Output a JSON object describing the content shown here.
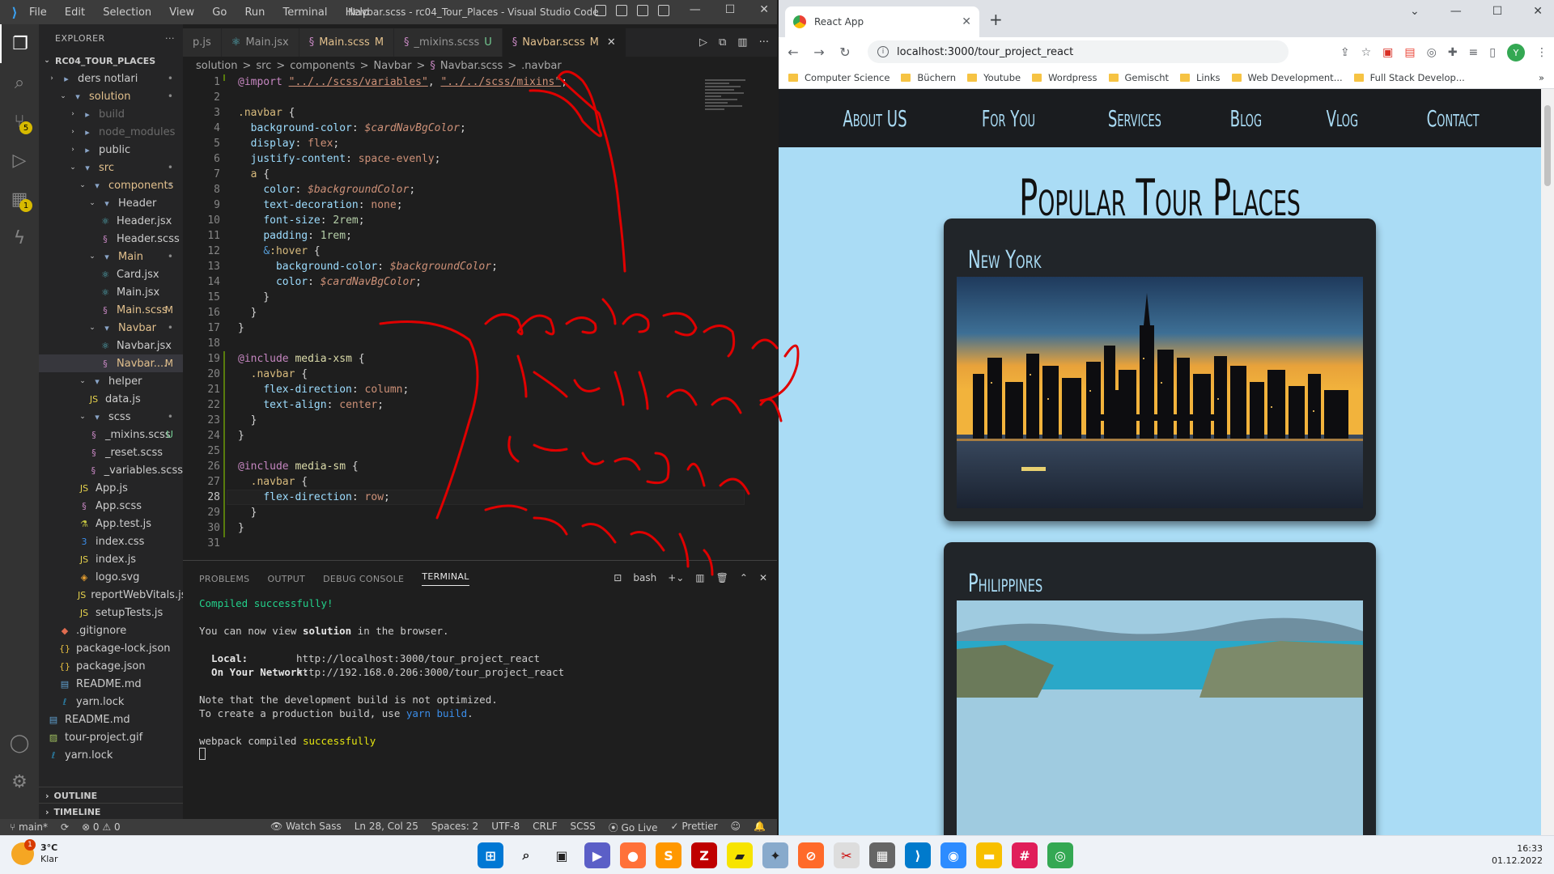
{
  "vscode": {
    "menu": [
      "File",
      "Edit",
      "Selection",
      "View",
      "Go",
      "Run",
      "Terminal",
      "Help"
    ],
    "window_title": "Navbar.scss - rc04_Tour_Places - Visual Studio Code",
    "activity_badges": {
      "scm": "5",
      "extensions": "1"
    },
    "explorer": {
      "title": "EXPLORER",
      "root": "RC04_TOUR_PLACES",
      "items": [
        {
          "label": "ders notlari",
          "icon": "folder",
          "color": "#cccccc",
          "status": "•"
        },
        {
          "label": "solution",
          "icon": "folder-open",
          "color": "#e2c08d",
          "status": "•"
        },
        {
          "label": "build",
          "icon": "folder",
          "color": "#6b6b6b",
          "status": ""
        },
        {
          "label": "node_modules",
          "icon": "folder",
          "color": "#6b6b6b",
          "status": ""
        },
        {
          "label": "public",
          "icon": "folder",
          "color": "#cccccc",
          "status": ""
        },
        {
          "label": "src",
          "icon": "folder-open",
          "color": "#e2c08d",
          "status": "•"
        },
        {
          "label": "components",
          "icon": "folder-open",
          "color": "#e2c08d",
          "status": "•"
        },
        {
          "label": "Header",
          "icon": "folder-open",
          "color": "#cccccc",
          "status": ""
        },
        {
          "label": "Header.jsx",
          "icon": "react",
          "color": "#cccccc",
          "status": ""
        },
        {
          "label": "Header.scss",
          "icon": "sass",
          "color": "#cccccc",
          "status": ""
        },
        {
          "label": "Main",
          "icon": "folder-open",
          "color": "#e2c08d",
          "status": "•"
        },
        {
          "label": "Card.jsx",
          "icon": "react",
          "color": "#cccccc",
          "status": ""
        },
        {
          "label": "Main.jsx",
          "icon": "react",
          "color": "#cccccc",
          "status": ""
        },
        {
          "label": "Main.scss",
          "icon": "sass",
          "color": "#e2c08d",
          "status": "M"
        },
        {
          "label": "Navbar",
          "icon": "folder-open",
          "color": "#e2c08d",
          "status": "•"
        },
        {
          "label": "Navbar.jsx",
          "icon": "react",
          "color": "#cccccc",
          "status": ""
        },
        {
          "label": "Navbar....",
          "icon": "sass",
          "color": "#e2c08d",
          "status": "M"
        },
        {
          "label": "helper",
          "icon": "folder-open",
          "color": "#cccccc",
          "status": ""
        },
        {
          "label": "data.js",
          "icon": "js",
          "color": "#cccccc",
          "status": ""
        },
        {
          "label": "scss",
          "icon": "folder-open",
          "color": "#cccccc",
          "status": "•"
        },
        {
          "label": "_mixins.scss",
          "icon": "sass",
          "color": "#cccccc",
          "status": "U"
        },
        {
          "label": "_reset.scss",
          "icon": "sass",
          "color": "#cccccc",
          "status": ""
        },
        {
          "label": "_variables.scss",
          "icon": "sass",
          "color": "#cccccc",
          "status": ""
        },
        {
          "label": "App.js",
          "icon": "js",
          "color": "#cccccc",
          "status": ""
        },
        {
          "label": "App.scss",
          "icon": "sass",
          "color": "#cccccc",
          "status": ""
        },
        {
          "label": "App.test.js",
          "icon": "test",
          "color": "#cccccc",
          "status": ""
        },
        {
          "label": "index.css",
          "icon": "css",
          "color": "#cccccc",
          "status": ""
        },
        {
          "label": "index.js",
          "icon": "js",
          "color": "#cccccc",
          "status": ""
        },
        {
          "label": "logo.svg",
          "icon": "svg",
          "color": "#cccccc",
          "status": ""
        },
        {
          "label": "reportWebVitals.js",
          "icon": "js",
          "color": "#cccccc",
          "status": ""
        },
        {
          "label": "setupTests.js",
          "icon": "js",
          "color": "#cccccc",
          "status": ""
        },
        {
          "label": ".gitignore",
          "icon": "git",
          "color": "#cccccc",
          "status": ""
        },
        {
          "label": "package-lock.json",
          "icon": "json",
          "color": "#cccccc",
          "status": ""
        },
        {
          "label": "package.json",
          "icon": "json",
          "color": "#cccccc",
          "status": ""
        },
        {
          "label": "README.md",
          "icon": "md",
          "color": "#cccccc",
          "status": ""
        },
        {
          "label": "yarn.lock",
          "icon": "yarn",
          "color": "#cccccc",
          "status": ""
        },
        {
          "label": "README.md",
          "icon": "md",
          "color": "#cccccc",
          "status": ""
        },
        {
          "label": "tour-project.gif",
          "icon": "img",
          "color": "#cccccc",
          "status": ""
        },
        {
          "label": "yarn.lock",
          "icon": "yarn",
          "color": "#cccccc",
          "status": ""
        }
      ],
      "outline": "OUTLINE",
      "timeline": "TIMELINE"
    },
    "tabs": [
      {
        "label": "p.js",
        "status": ""
      },
      {
        "label": "Main.jsx",
        "status": ""
      },
      {
        "label": "Main.scss",
        "status": "M"
      },
      {
        "label": "_mixins.scss",
        "status": "U"
      },
      {
        "label": "Navbar.scss",
        "status": "M"
      }
    ],
    "breadcrumb": [
      "solution",
      ">",
      "src",
      ">",
      "components",
      ">",
      "Navbar",
      ">",
      "Navbar.scss",
      ">",
      ".navbar"
    ],
    "current_line": "28",
    "panel": {
      "tabs": [
        "PROBLEMS",
        "OUTPUT",
        "DEBUG CONSOLE",
        "TERMINAL"
      ],
      "shell": "bash",
      "terminal": {
        "l1": "Compiled successfully!",
        "l2a": "You can now view ",
        "l2b": "solution",
        "l2c": " in the browser.",
        "local_label": "  Local:",
        "local_url": "http://localhost:3000/tour_project_react",
        "net_label": "  On Your Network:",
        "net_url": "http://192.168.0.206:3000/tour_project_react",
        "l5": "Note that the development build is not optimized.",
        "l6a": "To create a production build, use ",
        "l6b": "yarn build",
        "l6c": ".",
        "l7a": "webpack compiled ",
        "l7b": "successfully"
      }
    },
    "statusbar": {
      "branch": "main*",
      "errors": "⊗ 0 ⚠ 0",
      "watch": "Watch Sass",
      "position": "Ln 28, Col 25",
      "spaces": "Spaces: 2",
      "encoding": "UTF-8",
      "eol": "CRLF",
      "lang": "SCSS",
      "golive": "Go Live",
      "prettier": "✓ Prettier"
    }
  },
  "browser": {
    "tab_title": "React App",
    "url": "localhost:3000/tour_project_react",
    "profile": "Y",
    "bookmarks": [
      "Computer Science",
      "Büchern",
      "Youtube",
      "Wordpress",
      "Gemischt",
      "Links",
      "Web Development...",
      "Full Stack Develop..."
    ],
    "page": {
      "nav": [
        "About US",
        "For You",
        "Services",
        "Blog",
        "Vlog",
        "Contact"
      ],
      "title": "Popular Tour Places",
      "cards": [
        "New York",
        "Philippines"
      ]
    }
  },
  "taskbar": {
    "temp": "3°C",
    "weather": "Klar",
    "weather_badge": "1",
    "time": "16:33",
    "date": "01.12.2022"
  },
  "annotation": {
    "color": "#e00000",
    "meaning": "handwritten red ink note"
  }
}
